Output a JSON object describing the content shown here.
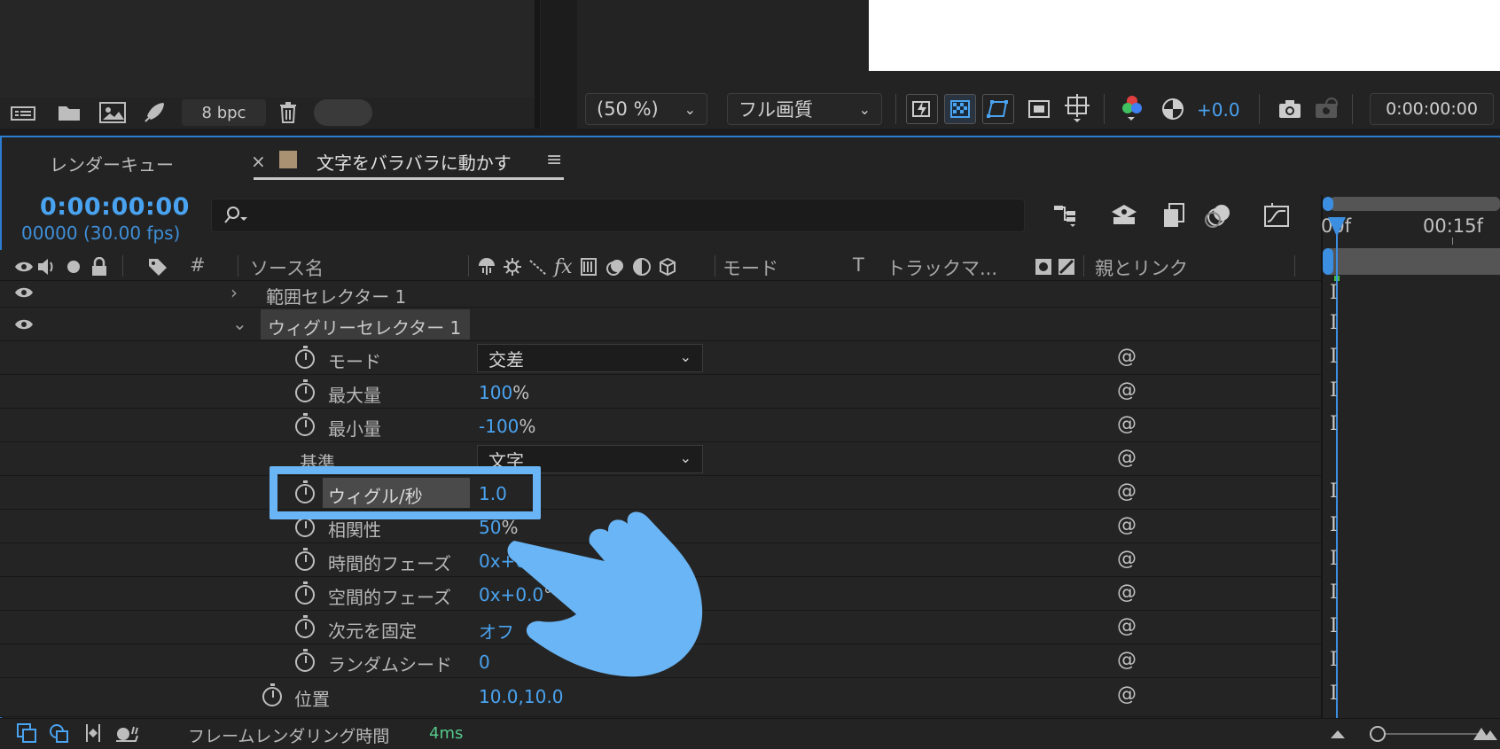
{
  "top_toolbar": {
    "bpc": "8 bpc",
    "zoom": "(50 %)",
    "quality": "フル画質",
    "exposure": "+0.0",
    "timecode": "0:00:00:00"
  },
  "tabs": {
    "render_queue": "レンダーキュー",
    "close": "×",
    "composition": "文字をバラバラに動かす",
    "menu": "≡"
  },
  "timeline": {
    "current_time": "0:00:00:00",
    "frame_info": "00000 (30.00 fps)",
    "search_placeholder": "",
    "ruler_labels": [
      "00f",
      "00:15f"
    ]
  },
  "columns": {
    "hash": "#",
    "source_name": "ソース名",
    "mode": "モード",
    "t": "T",
    "track_matte": "トラックマ...",
    "parent": "親とリンク"
  },
  "rows": [
    {
      "label": "範囲セレクター 1",
      "value": "",
      "unit": ""
    },
    {
      "label": "ウィグリーセレクター 1",
      "value": "",
      "unit": ""
    },
    {
      "label": "モード",
      "value": "交差",
      "unit": ""
    },
    {
      "label": "最大量",
      "value": "100",
      "unit": "%"
    },
    {
      "label": "最小量",
      "value": "-100",
      "unit": "%"
    },
    {
      "label": "基準",
      "value": "文字",
      "unit": ""
    },
    {
      "label": "ウィグル/秒",
      "value": "1.0",
      "unit": ""
    },
    {
      "label": "相関性",
      "value": "50",
      "unit": "%"
    },
    {
      "label": "時間的フェーズ",
      "value": "0x+0.0",
      "unit": ""
    },
    {
      "label": "空間的フェーズ",
      "value": "0x+0.0",
      "unit": "°"
    },
    {
      "label": "次元を固定",
      "value": "オフ",
      "unit": ""
    },
    {
      "label": "ランダムシード",
      "value": "0",
      "unit": ""
    },
    {
      "label": "位置",
      "value": "10.0,10.0",
      "unit": ""
    }
  ],
  "status_bar": {
    "label": "フレームレンダリング時間",
    "value": "4ms"
  },
  "colors": {
    "accent_blue": "#4aa3f0",
    "highlight": "#6ab5f5",
    "background": "#232323"
  }
}
